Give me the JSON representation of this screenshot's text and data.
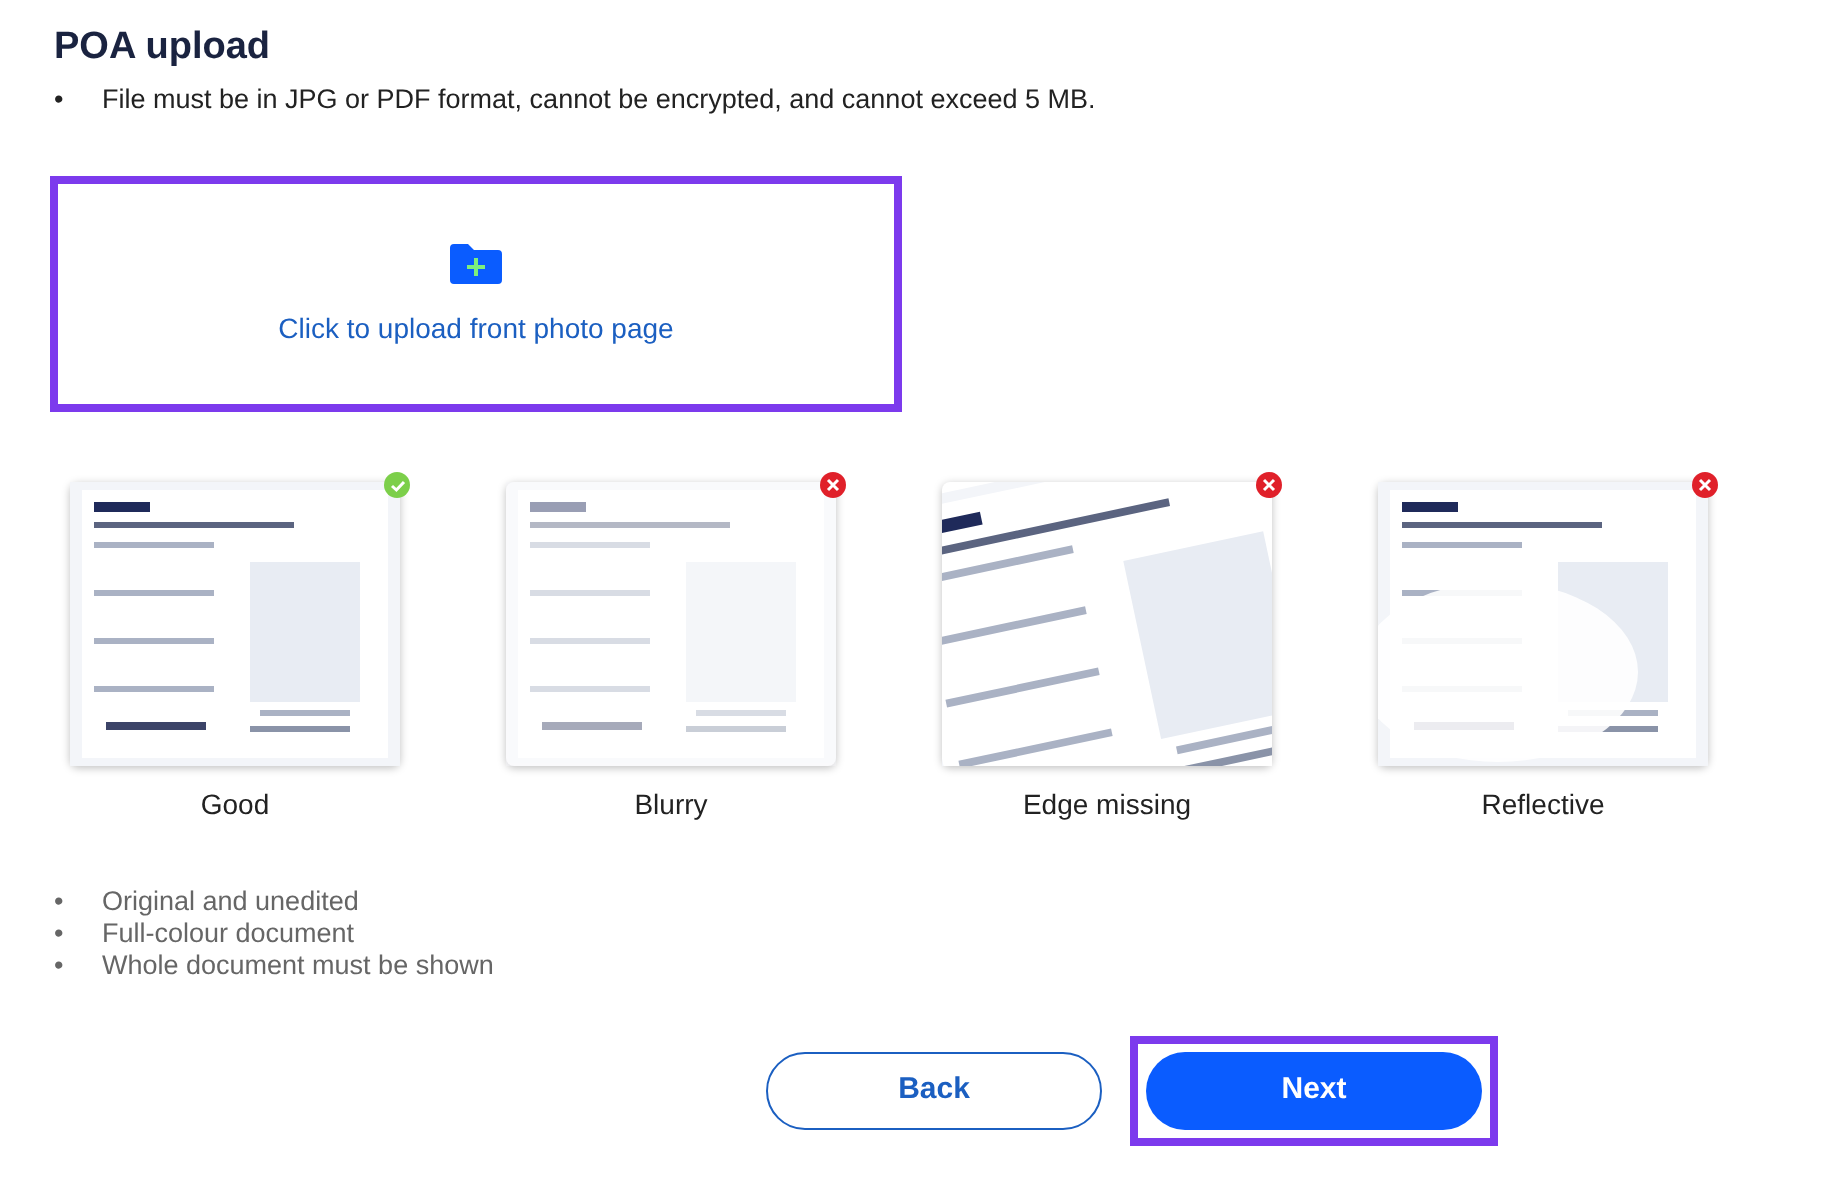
{
  "title": "POA upload",
  "requirements": [
    {
      "bullet": "•",
      "text": "File must be in JPG or PDF format, cannot be encrypted, and cannot exceed 5 MB."
    }
  ],
  "upload": {
    "label": "Click to upload front photo page",
    "highlighted": true
  },
  "examples": [
    {
      "label": "Good",
      "ok": true
    },
    {
      "label": "Blurry",
      "ok": false
    },
    {
      "label": "Edge missing",
      "ok": false
    },
    {
      "label": "Reflective",
      "ok": false
    }
  ],
  "checklist": [
    {
      "bullet": "•",
      "text": "Original and unedited"
    },
    {
      "bullet": "•",
      "text": "Full-colour document"
    },
    {
      "bullet": "•",
      "text": "Whole document must be shown"
    }
  ],
  "buttons": [
    {
      "label": "Back",
      "kind": "secondary",
      "highlighted": false
    },
    {
      "label": "Next",
      "kind": "primary",
      "highlighted": true
    }
  ]
}
